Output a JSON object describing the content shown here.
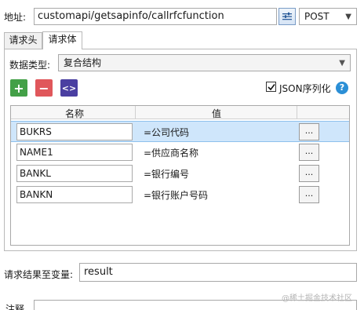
{
  "address": {
    "label": "地址:",
    "url": "customapi/getsapinfo/callrfcfunction",
    "method": "POST"
  },
  "tabs": [
    {
      "label": "请求头",
      "active": false
    },
    {
      "label": "请求体",
      "active": true
    }
  ],
  "body": {
    "data_type_label": "数据类型:",
    "data_type_value": "复合结构",
    "toolbar": {
      "add_symbol": "+",
      "remove_symbol": "−",
      "code_symbol": "<>"
    },
    "json_serialize": {
      "label": "JSON序列化",
      "checked": true
    },
    "help_symbol": "?",
    "columns": {
      "name": "名称",
      "value": "值"
    },
    "rows": [
      {
        "name": "BUKRS",
        "value": "=公司代码",
        "button": "...",
        "selected": true
      },
      {
        "name": "NAME1",
        "value": "=供应商名称",
        "button": "...",
        "selected": false
      },
      {
        "name": "BANKL",
        "value": "=银行编号",
        "button": "...",
        "selected": false
      },
      {
        "name": "BANKN",
        "value": "=银行账户号码",
        "button": "...",
        "selected": false
      }
    ]
  },
  "result": {
    "label": "请求结果至变量:",
    "value": "result"
  },
  "note": {
    "label": "注释"
  },
  "watermark": "@稀土掘金技术社区",
  "colors": {
    "add": "#43a047",
    "remove": "#e0575b",
    "code": "#4a3fa1",
    "help": "#2b8fd6",
    "selection": "#cfe6fb"
  }
}
